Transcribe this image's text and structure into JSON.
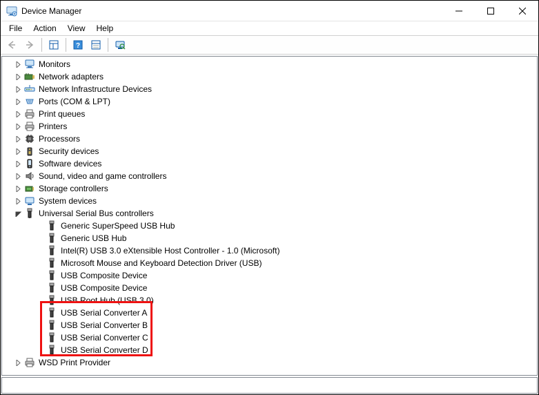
{
  "window": {
    "title": "Device Manager"
  },
  "menu": {
    "file": "File",
    "action": "Action",
    "view": "View",
    "help": "Help"
  },
  "categories": {
    "monitors": "Monitors",
    "network_adapters": "Network adapters",
    "network_infra": "Network Infrastructure Devices",
    "ports": "Ports (COM & LPT)",
    "print_queues": "Print queues",
    "printers": "Printers",
    "processors": "Processors",
    "security_devices": "Security devices",
    "software_devices": "Software devices",
    "sound": "Sound, video and game controllers",
    "storage_controllers": "Storage controllers",
    "system_devices": "System devices",
    "usb_controllers": "Universal Serial Bus controllers",
    "wsd_print": "WSD Print Provider"
  },
  "usb_children": {
    "generic_ss_hub": "Generic SuperSpeed USB Hub",
    "generic_hub": "Generic USB Hub",
    "intel_xhci": "Intel(R) USB 3.0 eXtensible Host Controller - 1.0 (Microsoft)",
    "ms_mouse_kb": "Microsoft Mouse and Keyboard Detection Driver (USB)",
    "composite1": "USB Composite Device",
    "composite2": "USB Composite Device",
    "root_hub": "USB Root Hub (USB 3.0)",
    "serial_a": "USB Serial Converter A",
    "serial_b": "USB Serial Converter B",
    "serial_c": "USB Serial Converter C",
    "serial_d": "USB Serial Converter D"
  }
}
